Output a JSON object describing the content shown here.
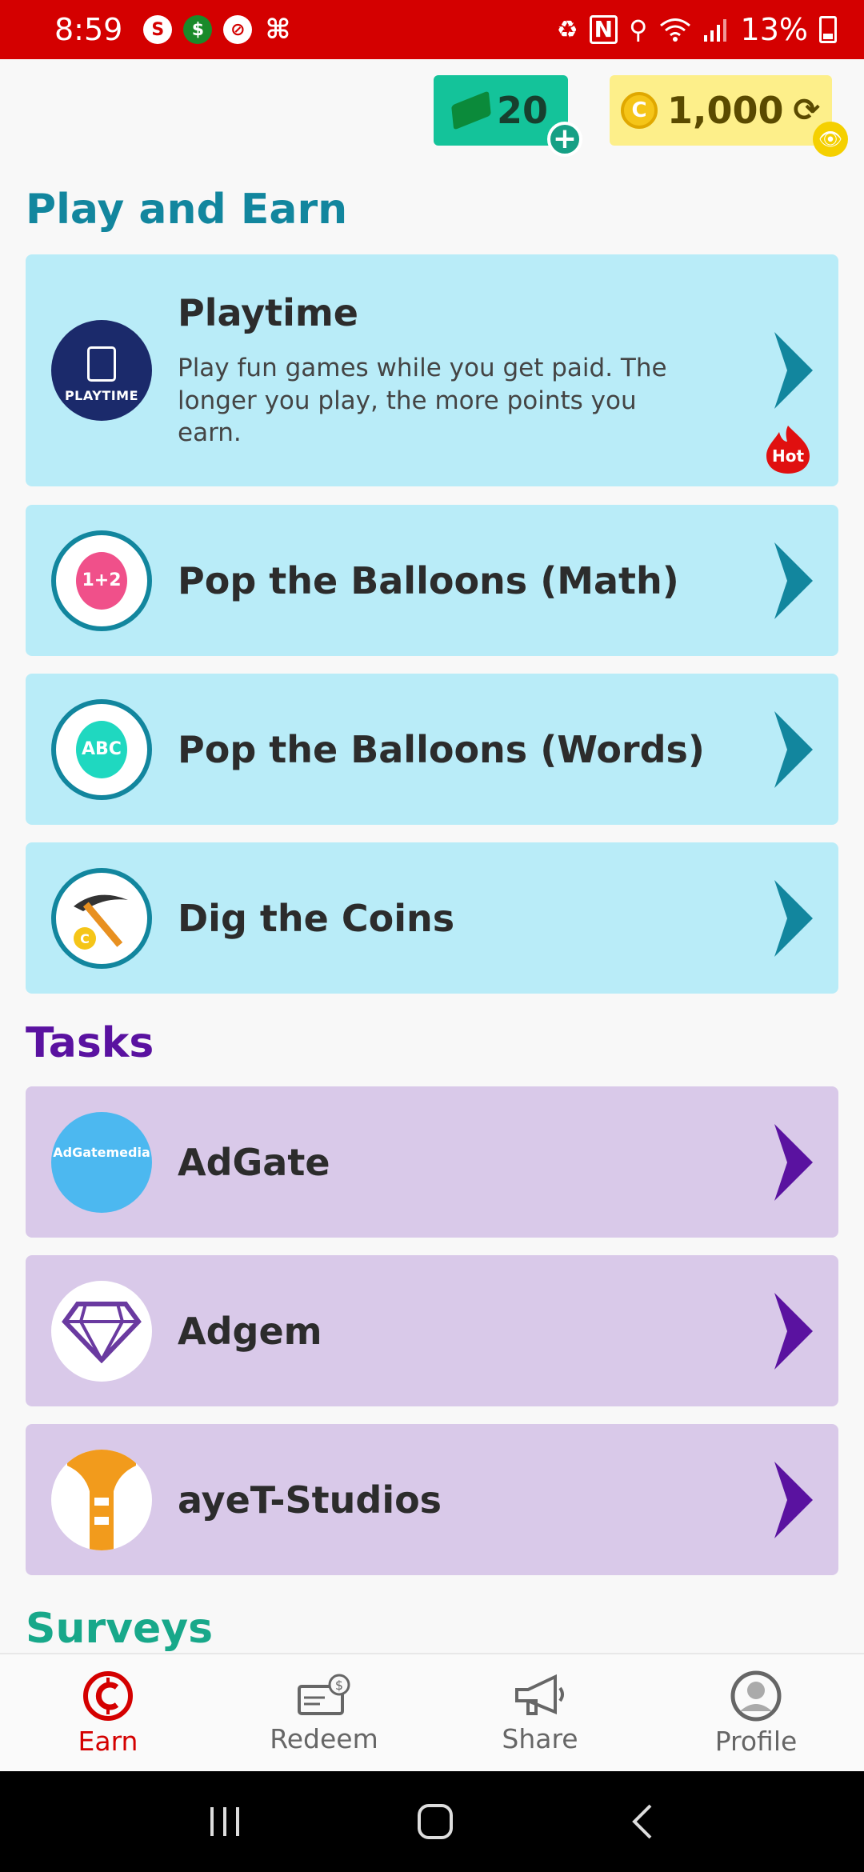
{
  "status_bar": {
    "time": "8:59",
    "battery": "13%",
    "colors": {
      "background": "#d40000"
    }
  },
  "header": {
    "tickets": "20",
    "coins": "1,000"
  },
  "play_section": {
    "title": "Play and Earn",
    "items": [
      {
        "name": "Playtime",
        "description": "Play fun games while you get paid. The longer you play, the more points you earn.",
        "logo_text": "PLAYTIME",
        "badge": "Hot"
      },
      {
        "name": "Pop the Balloons (Math)",
        "balloon_text": "1+2"
      },
      {
        "name": "Pop the Balloons (Words)",
        "balloon_text": "ABC"
      },
      {
        "name": "Dig the Coins"
      }
    ]
  },
  "tasks_section": {
    "title": "Tasks",
    "items": [
      {
        "name": "AdGate",
        "logo_text": "AdGatemedia"
      },
      {
        "name": "Adgem"
      },
      {
        "name": "ayeT-Studios"
      }
    ]
  },
  "surveys_section": {
    "title": "Surveys"
  },
  "bottom_nav": {
    "items": [
      {
        "label": "Earn",
        "icon": "earn-icon",
        "active": true
      },
      {
        "label": "Redeem",
        "icon": "redeem-icon"
      },
      {
        "label": "Share",
        "icon": "megaphone-icon"
      },
      {
        "label": "Profile",
        "icon": "profile-icon"
      }
    ]
  },
  "colors": {
    "play_card": "#b9ecf8",
    "task_card": "#d9c9e9",
    "play_accent": "#12869e",
    "task_accent": "#5a12a0",
    "survey_accent": "#18a88a",
    "active_nav": "#d40000"
  }
}
